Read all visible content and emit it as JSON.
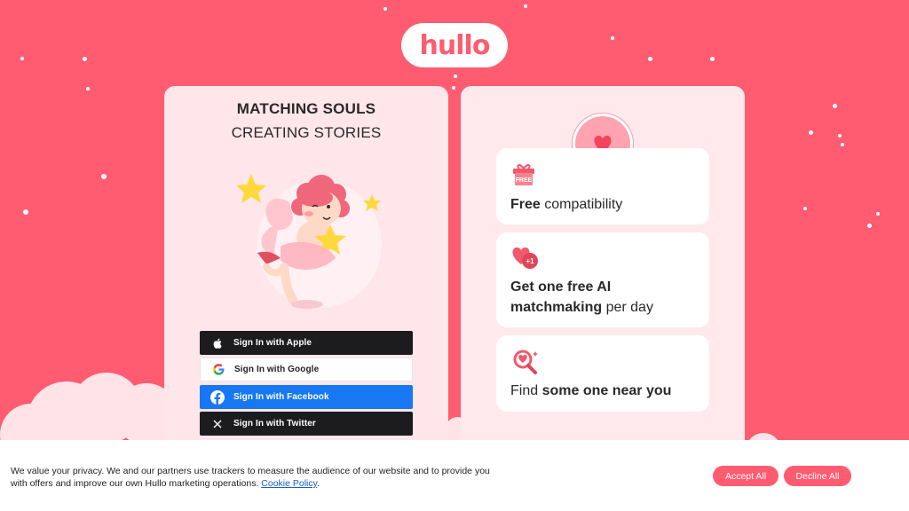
{
  "brand": {
    "logo_text": "hullo",
    "accent": "#ff5c71"
  },
  "left_card": {
    "headline_1": "MATCHING SOULS",
    "headline_2": "CREATING STORIES",
    "buttons": [
      {
        "label": "Sign In with Apple",
        "icon": "apple-icon"
      },
      {
        "label": "Sign In with Google",
        "icon": "google-icon"
      },
      {
        "label": "Sign In with Facebook",
        "icon": "facebook-icon"
      },
      {
        "label": "Sign In with Twitter",
        "icon": "x-twitter-icon"
      }
    ]
  },
  "right_card": {
    "features": [
      {
        "icon": "free-gift-icon",
        "icon_text": "FREE",
        "bold": "Free",
        "rest": " compatibility"
      },
      {
        "icon": "heart-plus-one-icon",
        "icon_text": "+1",
        "bold": "Get one free AI matchmaking",
        "rest": " per day"
      },
      {
        "icon": "heart-search-icon",
        "pre": "Find ",
        "bold": "some one near you"
      }
    ]
  },
  "cookie": {
    "text": "We value your privacy. We and our partners use trackers to measure the audience of our website and to provide you with offers and improve our own Hullo marketing operations. ",
    "link": "Cookie Policy",
    "after_link": ".",
    "accept_label": "Accept All",
    "decline_label": "Decline All"
  }
}
